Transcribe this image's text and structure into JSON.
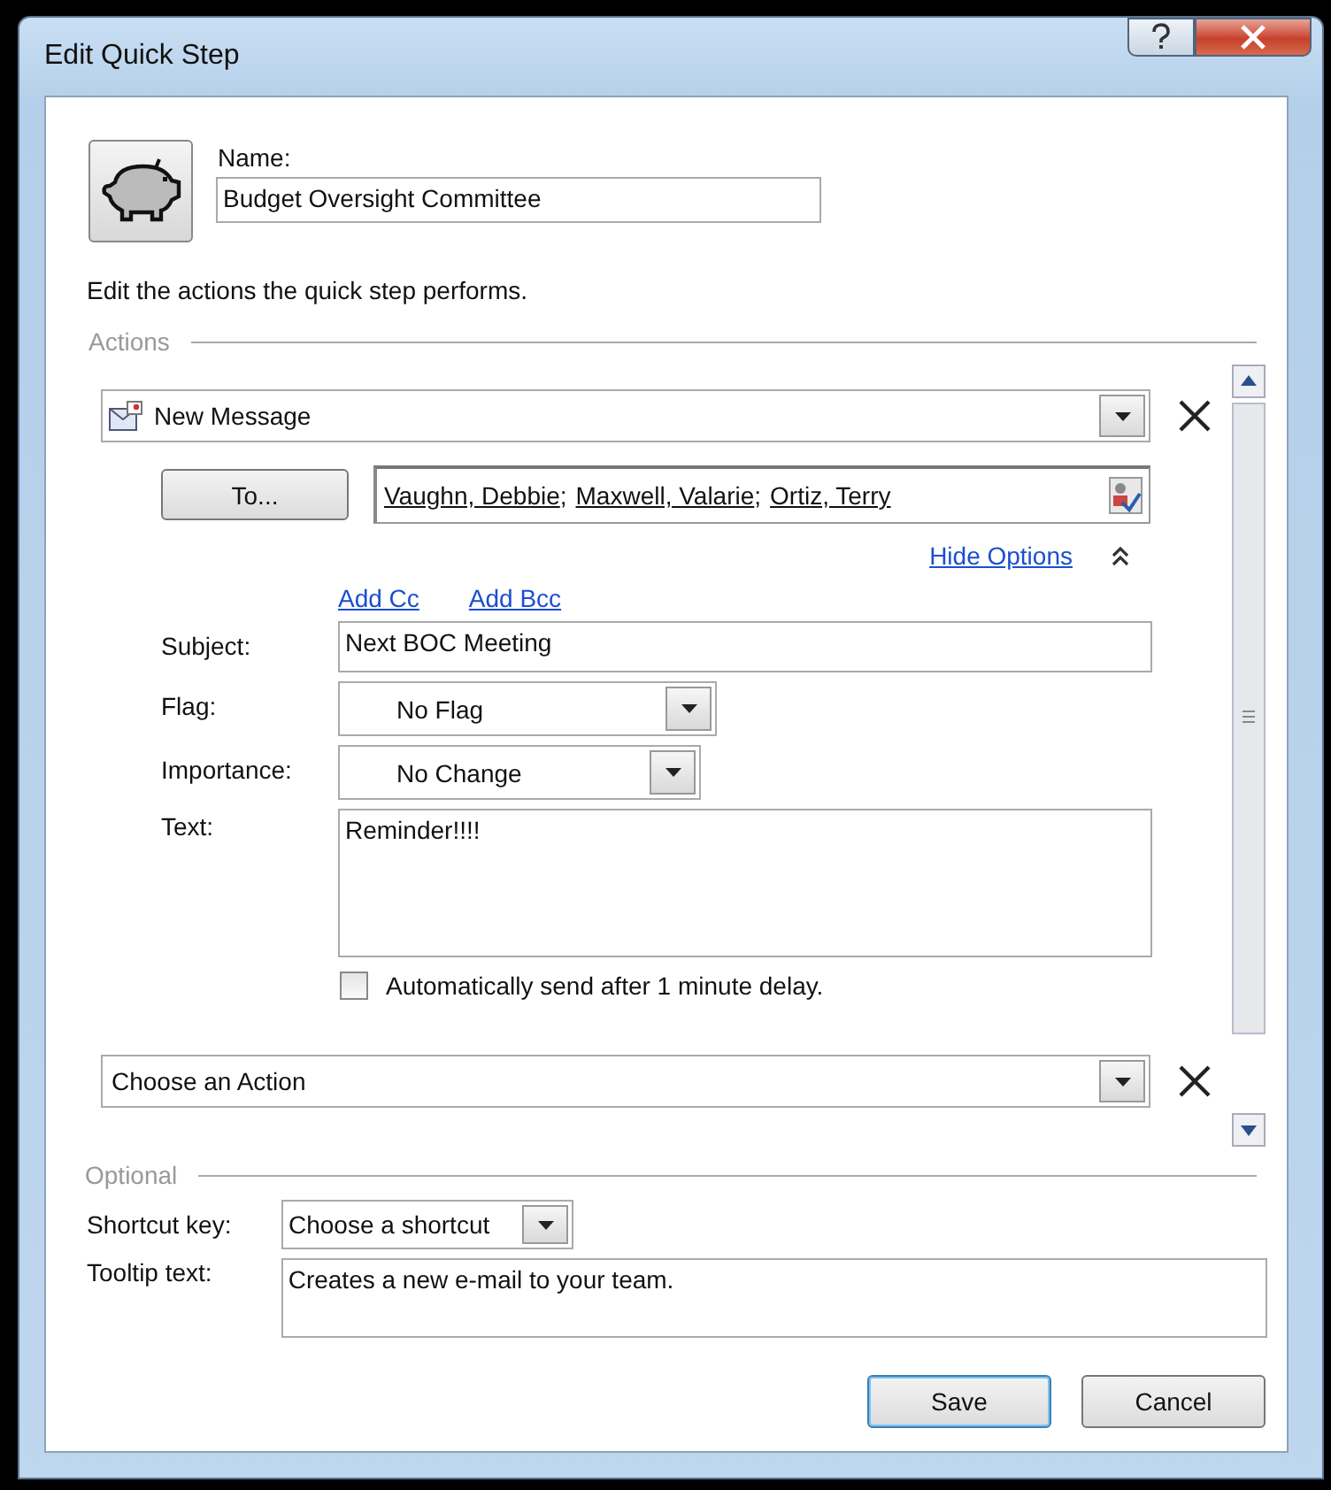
{
  "window": {
    "title": "Edit Quick Step"
  },
  "name": {
    "label": "Name:",
    "value": "Budget Oversight Committee"
  },
  "description": "Edit the actions the quick step performs.",
  "actions": {
    "legend": "Actions",
    "items": [
      {
        "kind": "message",
        "action": "New Message",
        "to_button": "To...",
        "recipients": [
          "Vaughn, Debbie",
          "Maxwell, Valarie",
          "Ortiz, Terry"
        ],
        "recipient_separator": ";",
        "hide_options": "Hide Options",
        "add_cc": "Add Cc",
        "add_bcc": "Add Bcc",
        "fields": [
          {
            "kind": "text",
            "label": "Subject:",
            "value": "Next BOC Meeting"
          },
          {
            "kind": "dropdown",
            "label": "Flag:",
            "value": "No Flag"
          },
          {
            "kind": "dropdown",
            "label": "Importance:",
            "value": "No Change"
          },
          {
            "kind": "textarea",
            "label": "Text:",
            "value": "Reminder!!!!"
          }
        ],
        "auto_send": {
          "label": "Automatically send after 1 minute delay.",
          "checked": false
        }
      },
      {
        "kind": "empty",
        "action": "Choose an Action"
      }
    ]
  },
  "optional": {
    "legend": "Optional",
    "shortcut": {
      "label": "Shortcut key:",
      "value": "Choose a shortcut"
    },
    "tooltip": {
      "label": "Tooltip text:",
      "value": "Creates a new e-mail to your team."
    }
  },
  "buttons": [
    {
      "label": "Save",
      "default": true
    },
    {
      "label": "Cancel",
      "default": false
    }
  ]
}
